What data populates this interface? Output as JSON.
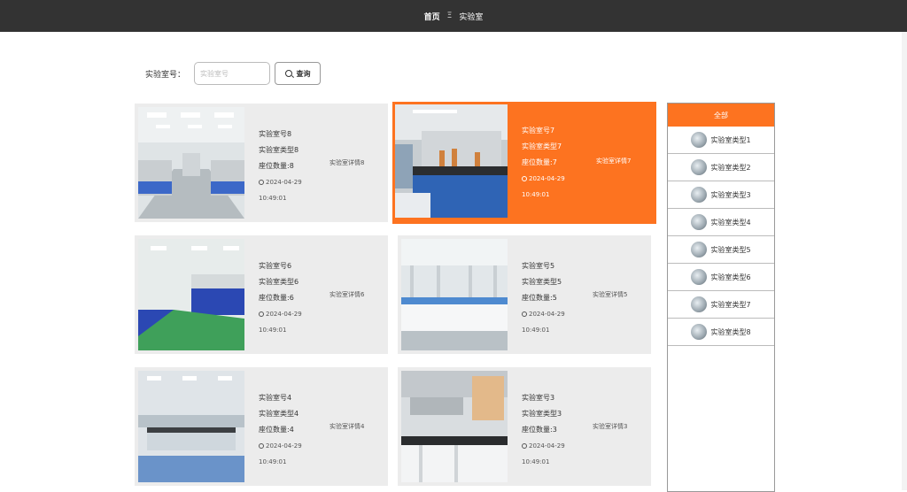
{
  "nav": {
    "home": "首页",
    "separator": "Ξ",
    "current": "实验室"
  },
  "search": {
    "label": "实验室号：",
    "placeholder": "实验室号",
    "button": "查询"
  },
  "cards": [
    {
      "name": "实验室号8",
      "type": "实验室类型8",
      "seats": "座位数量:8",
      "date": "2024-04-29",
      "time": "10:49:01",
      "detail": "实验室详情8",
      "active": false
    },
    {
      "name": "实验室号7",
      "type": "实验室类型7",
      "seats": "座位数量:7",
      "date": "2024-04-29",
      "time": "10:49:01",
      "detail": "实验室详情7",
      "active": true
    },
    {
      "name": "实验室号6",
      "type": "实验室类型6",
      "seats": "座位数量:6",
      "date": "2024-04-29",
      "time": "10:49:01",
      "detail": "实验室详情6",
      "active": false
    },
    {
      "name": "实验室号5",
      "type": "实验室类型5",
      "seats": "座位数量:5",
      "date": "2024-04-29",
      "time": "10:49:01",
      "detail": "实验室详情5",
      "active": false
    },
    {
      "name": "实验室号4",
      "type": "实验室类型4",
      "seats": "座位数量:4",
      "date": "2024-04-29",
      "time": "10:49:01",
      "detail": "实验室详情4",
      "active": false
    },
    {
      "name": "实验室号3",
      "type": "实验室类型3",
      "seats": "座位数量:3",
      "date": "2024-04-29",
      "time": "10:49:01",
      "detail": "实验室详情3",
      "active": false
    }
  ],
  "sidebar": {
    "header": "全部",
    "items": [
      "实验室类型1",
      "实验室类型2",
      "实验室类型3",
      "实验室类型4",
      "实验室类型5",
      "实验室类型6",
      "实验室类型7",
      "实验室类型8"
    ]
  },
  "colors": {
    "accent": "#fd7320",
    "topbar": "#333333",
    "card_bg": "#ececec"
  }
}
